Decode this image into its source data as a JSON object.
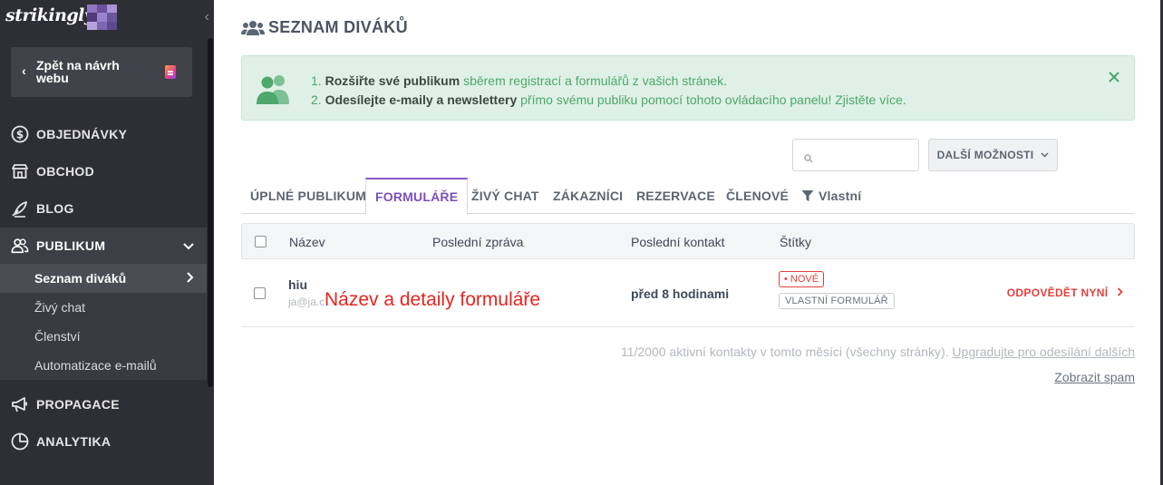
{
  "sidebar": {
    "logo": "strikingly",
    "mosaic_colors": [
      "#8f77c2",
      "#6c4f9e",
      "#a893d6",
      "#4f3a7a",
      "#9b82cc",
      "#6a579b",
      "#b4a3dd",
      "#7d66b3",
      "#5e4890"
    ],
    "back_label": "Zpět na návrh webu",
    "nav": [
      {
        "label": "OBJEDNÁVKY",
        "icon": "dollar-circle-icon"
      },
      {
        "label": "OBCHOD",
        "icon": "store-icon"
      },
      {
        "label": "BLOG",
        "icon": "feather-icon"
      },
      {
        "label": "PUBLIKUM",
        "icon": "users-icon"
      },
      {
        "label": "PROPAGACE",
        "icon": "megaphone-icon"
      },
      {
        "label": "ANALYTIKA",
        "icon": "pie-chart-icon"
      }
    ],
    "subnav": [
      {
        "label": "Seznam diváků"
      },
      {
        "label": "Živý chat"
      },
      {
        "label": "Členství"
      },
      {
        "label": "Automatizace e-mailů"
      }
    ]
  },
  "main": {
    "title": "SEZNAM DIVÁKŮ",
    "banner": {
      "line1_num": "1.",
      "line1_bold": "Rozšiřte své publikum",
      "line1_rest": "sběrem registrací a formulářů z vašich stránek.",
      "line2_num": "2.",
      "line2_bold": "Odesílejte e-maily a newslettery",
      "line2_rest": "přímo svému publiku pomocí tohoto ovládacího panelu! Zjistěte více."
    },
    "search": {
      "placeholder": "",
      "value": ""
    },
    "more_options": "DALŠÍ MOŽNOSTI",
    "tabs": [
      "ÚPLNÉ PUBLIKUM",
      "FORMULÁŘE",
      "ŽIVÝ CHAT",
      "ZÁKAZNÍCI",
      "REZERVACE",
      "ČLENOVÉ",
      "Vlastní"
    ],
    "table": {
      "headers": [
        "Název",
        "Poslední zpráva",
        "Poslední kontakt",
        "Štítky"
      ],
      "rows": [
        {
          "name": "hiu",
          "email": "ja@ja.c",
          "overlay": "Název a detaily formuláře",
          "last_contact": "před 8 hodinami",
          "tag_new": "• NOVÉ",
          "tag_form": "VLASTNÍ FORMULÁŘ",
          "action": "ODPOVĚDĚT NYNÍ"
        }
      ]
    },
    "footer": {
      "note": "11/2000 aktivní kontakty v tomto měsíci (všechny stránky).",
      "upgrade_link": "Upgradujte pro odesílání dalších",
      "spam_link": "Zobrazit spam"
    }
  }
}
